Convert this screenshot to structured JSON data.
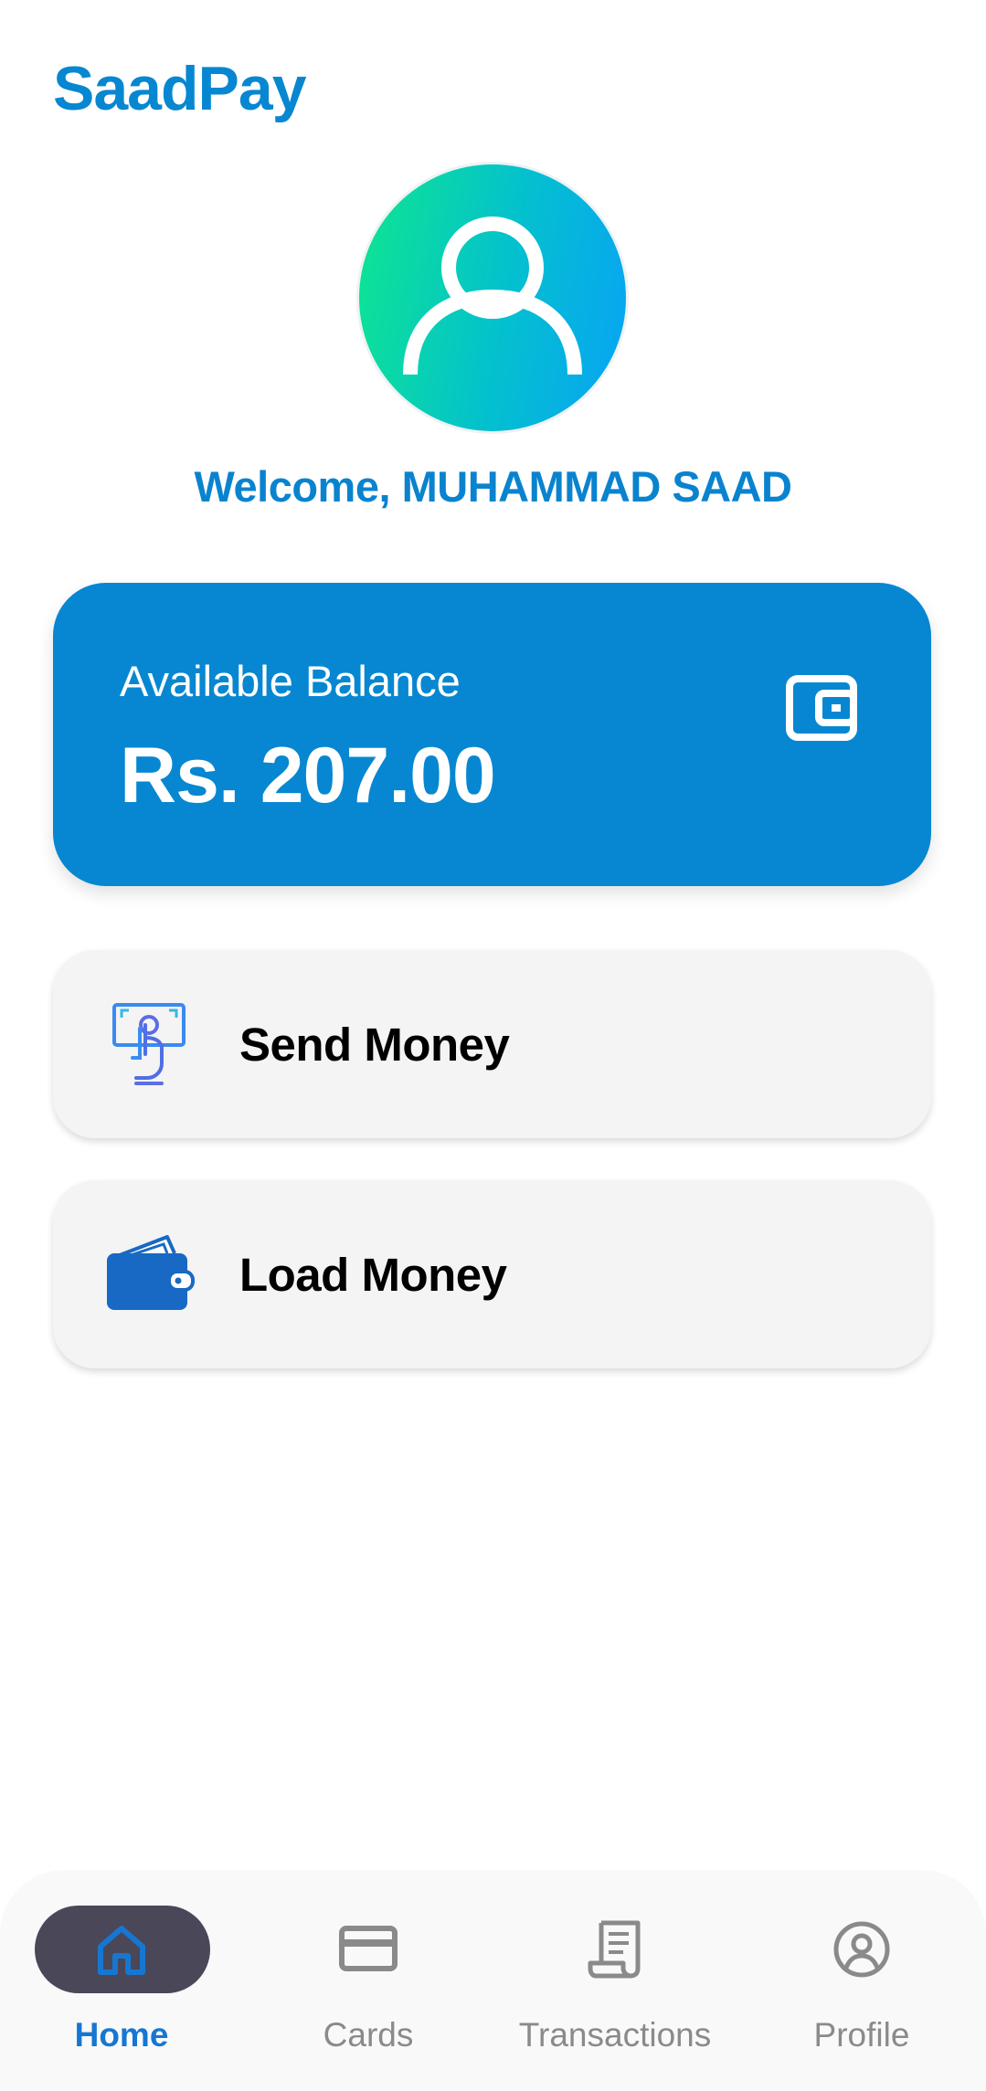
{
  "app": {
    "brand": "SaadPay",
    "welcome": "Welcome, MUHAMMAD SAAD"
  },
  "balance": {
    "label": "Available Balance",
    "amount": "Rs. 207.00",
    "icon": "wallet-icon"
  },
  "actions": [
    {
      "label": "Send Money",
      "icon": "send-money-icon"
    },
    {
      "label": "Load Money",
      "icon": "load-money-wallet-icon"
    }
  ],
  "nav": {
    "active": "Home",
    "items": [
      {
        "label": "Home",
        "icon": "home-icon"
      },
      {
        "label": "Cards",
        "icon": "card-icon"
      },
      {
        "label": "Transactions",
        "icon": "receipt-icon"
      },
      {
        "label": "Profile",
        "icon": "profile-icon"
      }
    ]
  },
  "colors": {
    "brand": "#0787d1",
    "card_bg": "#f4f4f4",
    "nav_active": "#1677d2",
    "nav_inactive": "#8a8a8a",
    "nav_pill": "#4a4759"
  }
}
